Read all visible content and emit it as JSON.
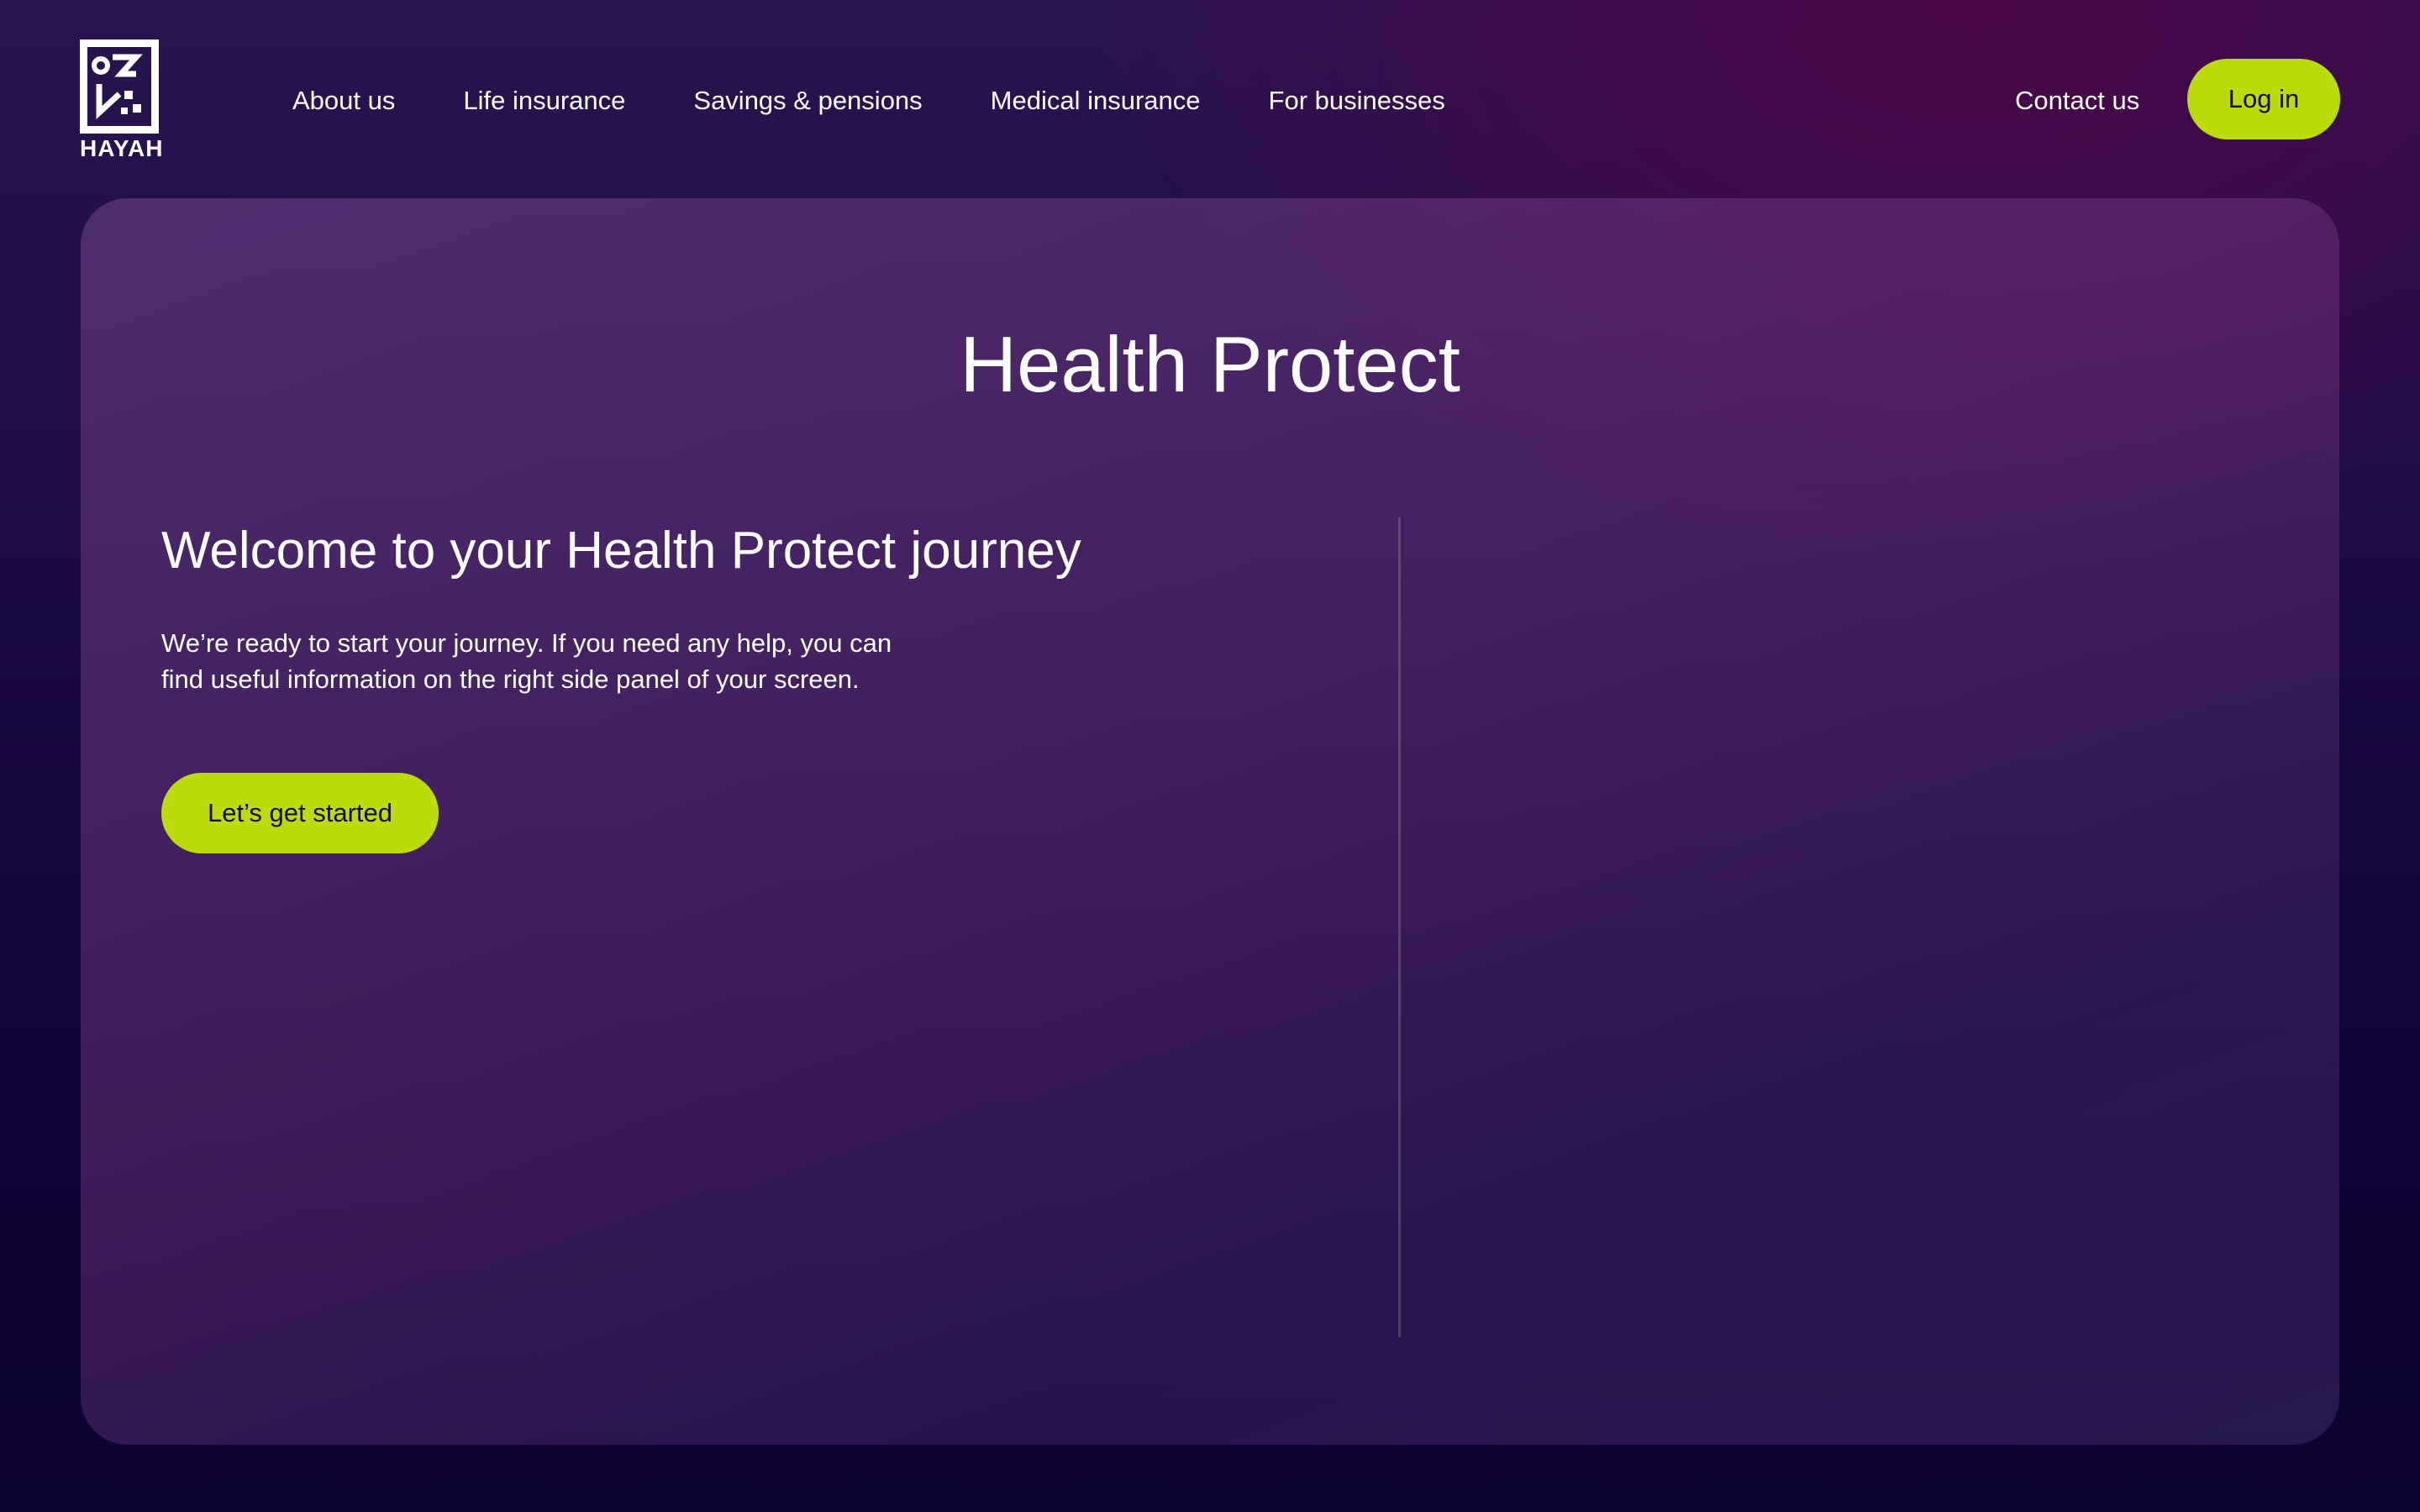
{
  "brand": {
    "logo_word": "HAYAH",
    "accent_color": "#bcdc0a"
  },
  "nav": {
    "items": [
      {
        "label": "About us"
      },
      {
        "label": "Life insurance"
      },
      {
        "label": "Savings & pensions"
      },
      {
        "label": "Medical insurance"
      },
      {
        "label": "For businesses"
      }
    ],
    "contact_label": "Contact us",
    "login_label": "Log in"
  },
  "main": {
    "title": "Health Protect",
    "welcome_title": "Welcome to your Health Protect journey",
    "welcome_text_line1": "We’re ready to start your journey. If you need any help, you can",
    "welcome_text_line2": "find useful information on the right side panel of your screen.",
    "start_label": "Let’s get started"
  }
}
